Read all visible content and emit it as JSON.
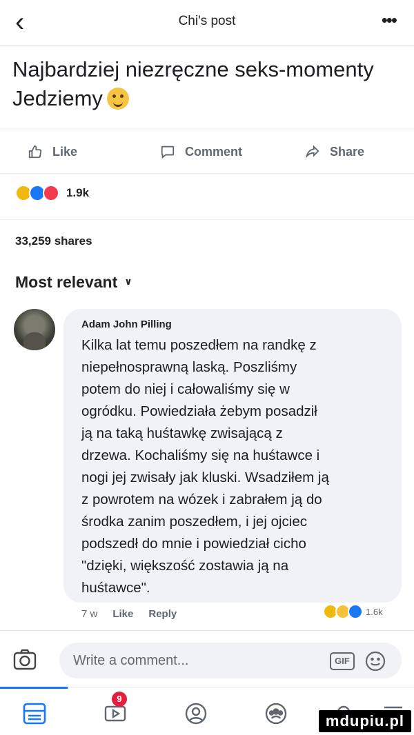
{
  "header": {
    "title": "Chi's post",
    "back_icon": "chevron-left-icon",
    "more_icon": "more-dots-icon"
  },
  "post": {
    "text": "Najbardziej niezręczne seks-momenty Jedziemy",
    "emoji": "grinning-face-emoji"
  },
  "actions": {
    "like_label": "Like",
    "comment_label": "Comment",
    "share_label": "Share"
  },
  "reactions": {
    "count": "1.9k",
    "types": [
      "haha",
      "like",
      "love"
    ]
  },
  "shares": "33,259 shares",
  "sort": {
    "label": "Most relevant"
  },
  "comment": {
    "author": "Adam John Pilling",
    "text": "Kilka lat temu poszedłem na randkę z\nniepełnosprawną laską. Poszliśmy\npotem do niej i całowaliśmy się w\nogródku. Powiedziała żebym posadził\nją na taką huśtawkę zwisającą z\ndrzewa. Kochaliśmy się na huśtawce i\nnogi jej zwisały jak kluski. Wsadziłem ją\nz powrotem na wózek i zabrałem ją do\nśrodka zanim poszedłem, i jej ojciec\npodszedł do mnie i powiedział cicho\n\"dzięki, większość zostawia ją na\nhuśtawce\".",
    "time": "7 w",
    "like_label": "Like",
    "reply_label": "Reply",
    "reaction_count": "1.6k",
    "reaction_types": [
      "haha",
      "wow",
      "like"
    ]
  },
  "composer": {
    "placeholder": "Write a comment...",
    "gif_label": "GIF"
  },
  "tabbar": {
    "notification_badge": "9"
  },
  "watermark": "mdupiu.pl",
  "colors": {
    "accent": "#1877f2",
    "badge": "#e41e3f",
    "bubble": "#f0f2f5"
  }
}
